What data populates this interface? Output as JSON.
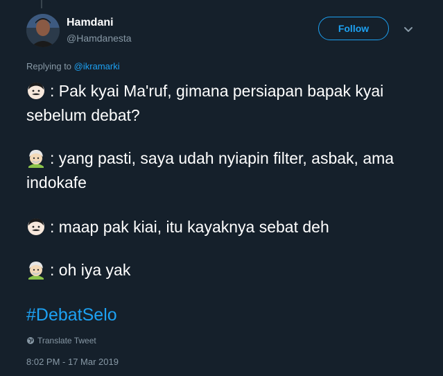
{
  "user": {
    "display_name": "Hamdani",
    "handle": "@Hamdanesta"
  },
  "header": {
    "follow_label": "Follow"
  },
  "reply": {
    "prefix": "Replying to",
    "mention": "@ikramarki"
  },
  "tweet": {
    "paragraphs": [
      {
        "emoji": "man-face-icon",
        "text": ": Pak kyai Ma'ruf, gimana persiapan bapak kyai sebelum debat?"
      },
      {
        "emoji": "old-man-turban-icon",
        "text": ": yang pasti, saya udah nyiapin filter, asbak, ama indokafe"
      },
      {
        "emoji": "man-face-icon",
        "text": ": maap pak kiai, itu kayaknya sebat deh"
      },
      {
        "emoji": "old-man-turban-icon",
        "text": ": oh iya yak"
      }
    ],
    "hashtag": "#DebatSelo"
  },
  "footer": {
    "translate_label": "Translate Tweet",
    "timestamp": "8:02 PM - 17 Mar 2019"
  },
  "colors": {
    "background": "#15202b",
    "accent": "#1da1f2",
    "secondary_text": "#8899a6"
  }
}
